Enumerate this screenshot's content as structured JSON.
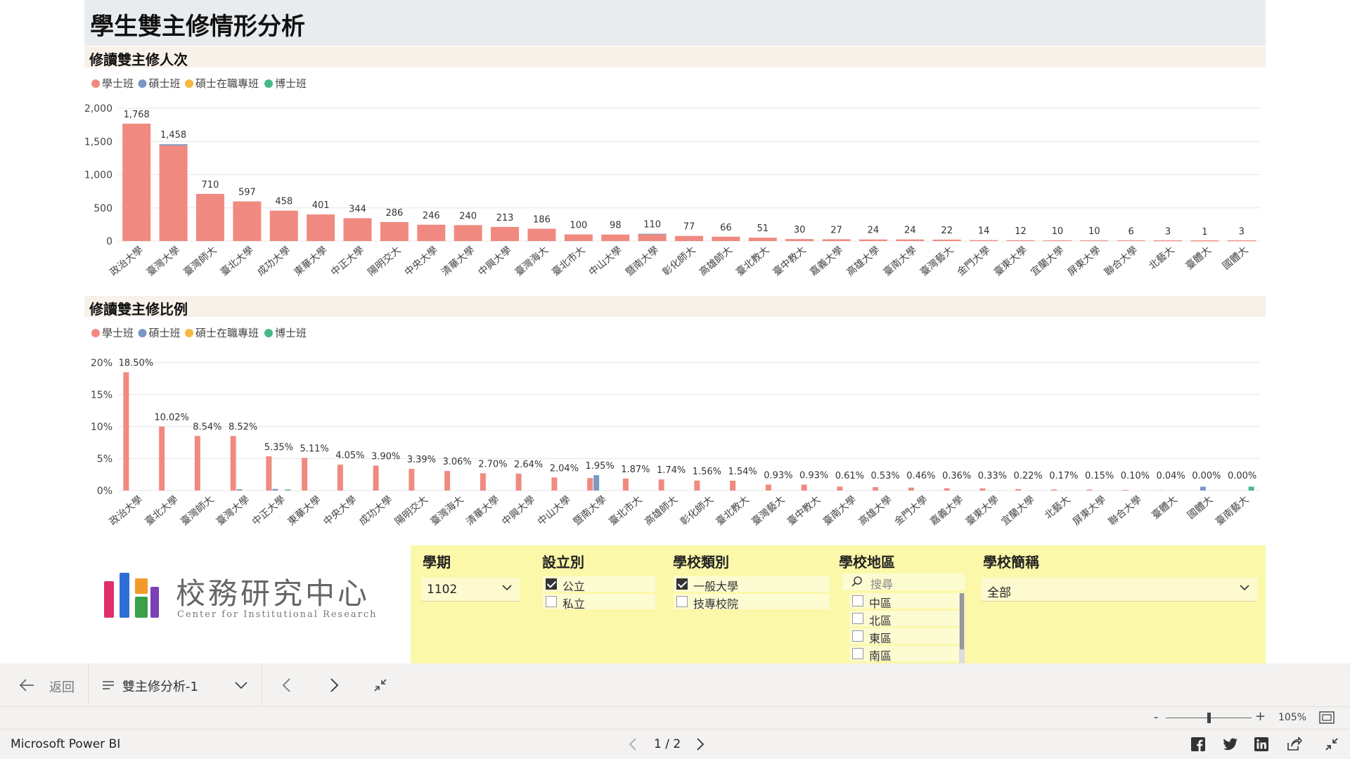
{
  "page": {
    "title": "學生雙主修情形分析"
  },
  "charts": {
    "count_title": "修讀雙主修人次",
    "ratio_title": "修讀雙主修比例",
    "legend": [
      {
        "label": "學士班",
        "color": "#f08a80"
      },
      {
        "label": "碩士班",
        "color": "#7b98c4"
      },
      {
        "label": "碩士在職專班",
        "color": "#f5b944"
      },
      {
        "label": "博士班",
        "color": "#46b78b"
      }
    ]
  },
  "chart_data": [
    {
      "type": "bar",
      "title": "修讀雙主修人次",
      "ylim": [
        0,
        2000
      ],
      "yticks": [
        "0",
        "500",
        "1,000",
        "1,500",
        "2,000"
      ],
      "grid": true,
      "legend_position": "top-left",
      "categories": [
        "政治大學",
        "臺灣大學",
        "臺灣師大",
        "臺北大學",
        "成功大學",
        "東華大學",
        "中正大學",
        "陽明交大",
        "中央大學",
        "清華大學",
        "中興大學",
        "臺灣海大",
        "臺北市大",
        "中山大學",
        "暨南大學",
        "彰化師大",
        "高雄師大",
        "臺北教大",
        "臺中教大",
        "嘉義大學",
        "高雄大學",
        "臺南大學",
        "臺灣藝大",
        "金門大學",
        "臺東大學",
        "宜蘭大學",
        "屏東大學",
        "聯合大學",
        "北藝大",
        "臺體大",
        "國體大"
      ],
      "total_labels": [
        "1,768",
        "1,458",
        "710",
        "597",
        "458",
        "401",
        "344",
        "286",
        "246",
        "240",
        "213",
        "186",
        "100",
        "98",
        "110",
        "77",
        "66",
        "51",
        "30",
        "27",
        "24",
        "24",
        "22",
        "14",
        "12",
        "10",
        "10",
        "6",
        "3",
        "1",
        "3"
      ],
      "series": [
        {
          "name": "學士班",
          "values": [
            1768,
            1440,
            710,
            597,
            458,
            401,
            344,
            286,
            246,
            240,
            213,
            186,
            100,
            98,
            100,
            77,
            66,
            51,
            30,
            27,
            24,
            24,
            22,
            14,
            12,
            10,
            10,
            6,
            3,
            1,
            3
          ]
        },
        {
          "name": "碩士班",
          "values": [
            0,
            18,
            0,
            0,
            0,
            0,
            0,
            0,
            0,
            0,
            0,
            0,
            0,
            0,
            10,
            0,
            0,
            0,
            0,
            0,
            0,
            0,
            0,
            0,
            0,
            0,
            0,
            0,
            0,
            0,
            0
          ]
        },
        {
          "name": "碩士在職專班",
          "values": [
            0,
            0,
            0,
            0,
            0,
            0,
            0,
            0,
            0,
            0,
            0,
            0,
            0,
            0,
            0,
            0,
            0,
            0,
            0,
            0,
            0,
            0,
            0,
            0,
            0,
            0,
            0,
            0,
            0,
            0,
            0
          ]
        },
        {
          "name": "博士班",
          "values": [
            0,
            0,
            0,
            0,
            0,
            0,
            0,
            0,
            0,
            0,
            0,
            0,
            0,
            0,
            0,
            0,
            0,
            0,
            0,
            0,
            0,
            0,
            0,
            0,
            0,
            0,
            0,
            0,
            0,
            0,
            0
          ]
        }
      ]
    },
    {
      "type": "bar",
      "title": "修讀雙主修比例",
      "ylim": [
        0,
        20
      ],
      "yticks": [
        "0%",
        "5%",
        "10%",
        "15%",
        "20%"
      ],
      "grid": true,
      "legend_position": "top-left",
      "categories": [
        "政治大學",
        "臺北大學",
        "臺灣師大",
        "臺灣大學",
        "中正大學",
        "東華大學",
        "中央大學",
        "成功大學",
        "陽明交大",
        "臺灣海大",
        "清華大學",
        "中興大學",
        "中山大學",
        "暨南大學",
        "臺北市大",
        "高雄師大",
        "彰化師大",
        "臺北教大",
        "臺灣藝大",
        "臺中教大",
        "臺南大學",
        "高雄大學",
        "金門大學",
        "嘉義大學",
        "臺東大學",
        "宜蘭大學",
        "北藝大",
        "屏東大學",
        "聯合大學",
        "臺體大",
        "國體大",
        "臺南藝大"
      ],
      "labels": [
        "18.50%",
        "10.02%",
        "8.54%",
        "8.52%",
        "5.35%",
        "5.11%",
        "4.05%",
        "3.90%",
        "3.39%",
        "3.06%",
        "2.70%",
        "2.64%",
        "2.04%",
        "1.95%",
        "1.87%",
        "1.74%",
        "1.56%",
        "1.54%",
        "0.93%",
        "0.93%",
        "0.61%",
        "0.53%",
        "0.46%",
        "0.36%",
        "0.33%",
        "0.22%",
        "0.17%",
        "0.15%",
        "0.10%",
        "0.04%",
        "0.00%",
        "0.00%"
      ],
      "series": [
        {
          "name": "學士班",
          "values": [
            18.5,
            10.02,
            8.54,
            8.52,
            5.35,
            5.11,
            4.05,
            3.9,
            3.39,
            3.06,
            2.7,
            2.64,
            2.04,
            1.95,
            1.87,
            1.74,
            1.56,
            1.54,
            0.93,
            0.93,
            0.61,
            0.53,
            0.46,
            0.36,
            0.33,
            0.22,
            0.17,
            0.15,
            0.1,
            0.04,
            0,
            0
          ]
        },
        {
          "name": "碩士班",
          "values": [
            0,
            0,
            0,
            0.2,
            0.25,
            0,
            0,
            0,
            0,
            0,
            0,
            0,
            0,
            2.4,
            0,
            0,
            0,
            0,
            0,
            0,
            0,
            0,
            0,
            0,
            0,
            0,
            0,
            0,
            0,
            0,
            0.6,
            0
          ]
        },
        {
          "name": "碩士在職專班",
          "values": [
            0,
            0,
            0,
            0,
            0,
            0,
            0,
            0,
            0,
            0,
            0,
            0,
            0,
            0,
            0,
            0,
            0,
            0,
            0,
            0,
            0,
            0,
            0,
            0,
            0,
            0,
            0,
            0,
            0,
            0,
            0,
            0
          ]
        },
        {
          "name": "博士班",
          "values": [
            0,
            0,
            0,
            0,
            0.15,
            0,
            0,
            0,
            0,
            0,
            0,
            0,
            0,
            0,
            0,
            0,
            0,
            0,
            0,
            0,
            0,
            0,
            0,
            0,
            0,
            0,
            0,
            0,
            0,
            0,
            0,
            0.6
          ]
        }
      ]
    }
  ],
  "logo": {
    "zh": "校務研究中心",
    "en": "Center for Institutional Research"
  },
  "slicers": {
    "semester": {
      "label": "學期",
      "value": "1102"
    },
    "establish": {
      "label": "設立別",
      "options": [
        {
          "label": "公立",
          "checked": true
        },
        {
          "label": "私立",
          "checked": false
        }
      ]
    },
    "school_type": {
      "label": "學校類別",
      "options": [
        {
          "label": "一般大學",
          "checked": true
        },
        {
          "label": "技專校院",
          "checked": false
        }
      ]
    },
    "region": {
      "label": "學校地區",
      "search_placeholder": "搜尋",
      "options": [
        {
          "label": "中區",
          "checked": false
        },
        {
          "label": "北區",
          "checked": false
        },
        {
          "label": "東區",
          "checked": false
        },
        {
          "label": "南區",
          "checked": false
        }
      ]
    },
    "school_name": {
      "label": "學校簡稱",
      "value": "全部"
    }
  },
  "nav": {
    "back_label": "返回",
    "page_name": "雙主修分析-1"
  },
  "zoom": {
    "level": "105%"
  },
  "footer": {
    "brand": "Microsoft Power BI",
    "page_indicator": "1 / 2"
  }
}
